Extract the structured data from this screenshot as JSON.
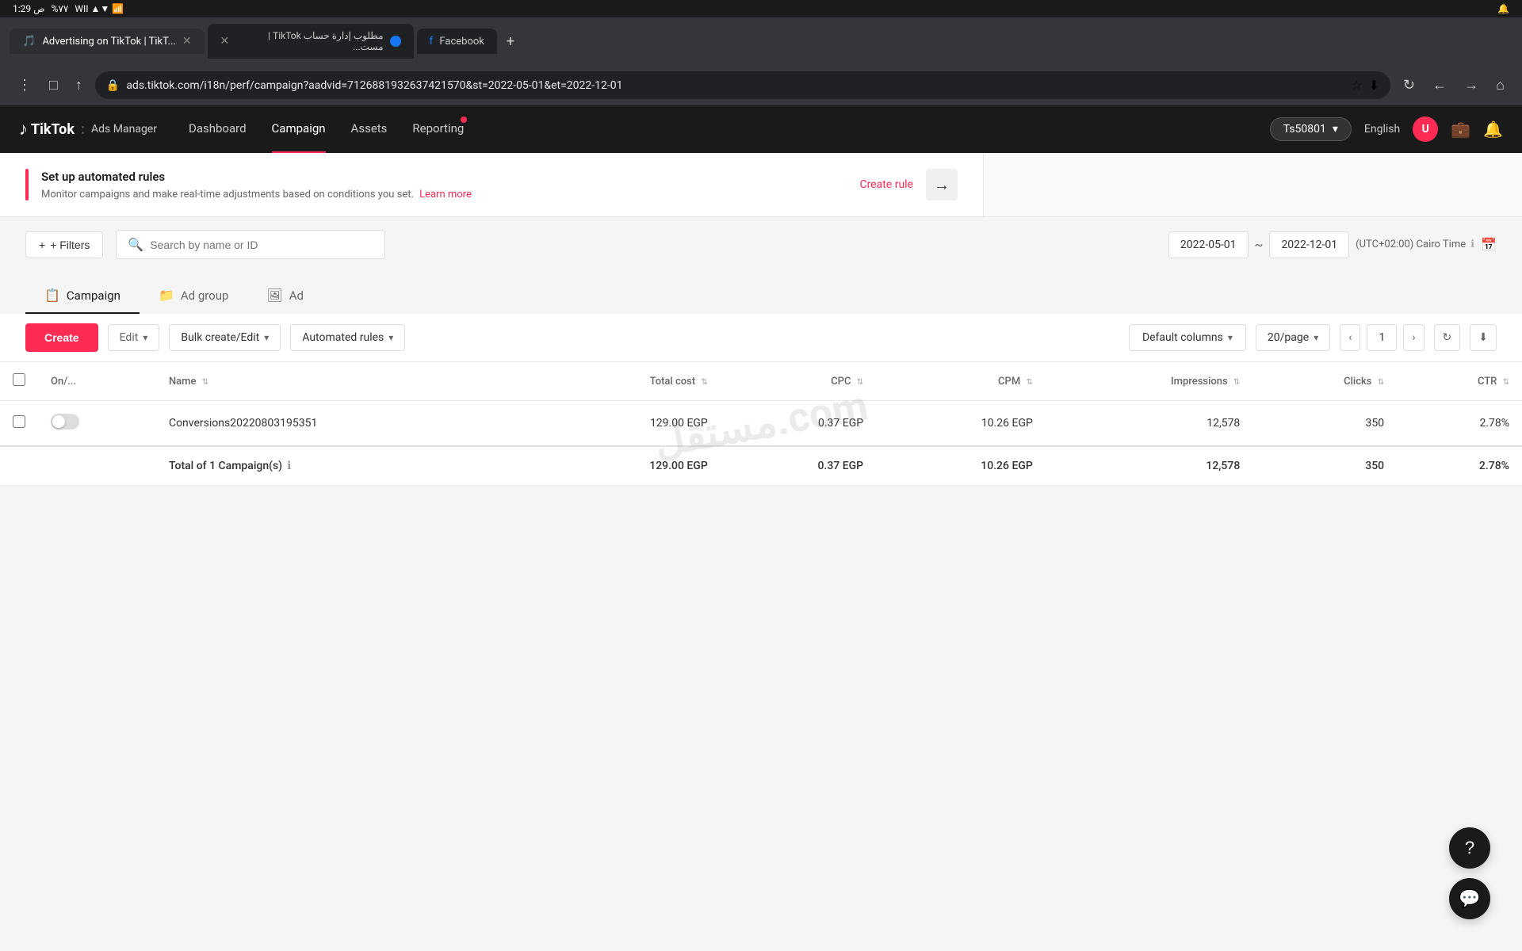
{
  "browser": {
    "status_bar": {
      "time": "1:29 ص",
      "battery": "%٧٧",
      "wifi": "WII"
    },
    "tabs": [
      {
        "id": "tab1",
        "title": "Advertising on TikTok | TikT...",
        "icon_color": "#000",
        "icon_type": "tiktok",
        "active": true,
        "has_close": true
      },
      {
        "id": "tab2",
        "title": "مطلوب إدارة حساب TikTok | مست...",
        "icon_color": "#1877f2",
        "icon_type": "circle-blue",
        "active": false,
        "has_close": true
      },
      {
        "id": "tab3",
        "title": "Facebook",
        "icon_color": "#1877f2",
        "icon_type": "facebook",
        "active": false,
        "has_close": false
      }
    ],
    "url": "ads.tiktok.com/i18n/perf/campaign?aadvid=7126881932637421570&st=2022-05-01&et=2022-12-01",
    "new_tab_label": "+",
    "back_label": "←",
    "forward_label": "→",
    "reload_label": "↻",
    "home_label": "⌂",
    "bookmark_label": "☆",
    "download_label": "⬇",
    "more_label": "⋮"
  },
  "header": {
    "logo": "TikTok",
    "logo_sub": "Ads Manager",
    "nav_items": [
      {
        "id": "dashboard",
        "label": "Dashboard",
        "active": false
      },
      {
        "id": "campaign",
        "label": "Campaign",
        "active": true
      },
      {
        "id": "assets",
        "label": "Assets",
        "active": false
      },
      {
        "id": "reporting",
        "label": "Reporting",
        "active": false,
        "has_dot": true
      }
    ],
    "account_selector": "Ts50801",
    "language": "English",
    "user_initial": "U"
  },
  "banner": {
    "left_border_color": "#fe2c55",
    "title": "Set up automated rules",
    "description": "Monitor campaigns and make real-time adjustments based on conditions you set.",
    "learn_more_label": "Learn more",
    "create_rule_label": "Create rule",
    "arrow_label": "→"
  },
  "filters": {
    "filters_label": "+ Filters",
    "search_placeholder": "Search by name or ID",
    "date_start": "2022-05-01",
    "date_end": "2022-12-01",
    "date_separator": "~",
    "timezone": "(UTC+02:00) Cairo Time",
    "timezone_info_icon": "ℹ"
  },
  "tabs": [
    {
      "id": "campaign",
      "label": "Campaign",
      "active": true,
      "icon": "📋"
    },
    {
      "id": "adgroup",
      "label": "Ad group",
      "active": false,
      "icon": "📁"
    },
    {
      "id": "ad",
      "label": "Ad",
      "active": false,
      "icon": "🖼"
    }
  ],
  "toolbar": {
    "create_label": "Create",
    "edit_label": "Edit",
    "bulk_label": "Bulk create/Edit",
    "auto_rules_label": "Automated rules",
    "columns_label": "Default columns",
    "per_page_label": "20/page",
    "page_current": "1",
    "refresh_icon": "↻",
    "export_icon": "⬇"
  },
  "table": {
    "columns": [
      {
        "id": "on_off",
        "label": "On/..."
      },
      {
        "id": "name",
        "label": "Name",
        "sortable": true
      },
      {
        "id": "total_cost",
        "label": "Total cost",
        "sortable": true,
        "align": "right"
      },
      {
        "id": "cpc",
        "label": "CPC",
        "sortable": true,
        "align": "right"
      },
      {
        "id": "cpm",
        "label": "CPM",
        "sortable": true,
        "align": "right"
      },
      {
        "id": "impressions",
        "label": "Impressions",
        "sortable": true,
        "align": "right"
      },
      {
        "id": "clicks",
        "label": "Clicks",
        "sortable": true,
        "align": "right"
      },
      {
        "id": "ctr",
        "label": "CTR",
        "sortable": true,
        "align": "right"
      }
    ],
    "rows": [
      {
        "id": "row1",
        "enabled": false,
        "name": "Conversions20220803195351",
        "total_cost": "129.00 EGP",
        "cpc": "0.37 EGP",
        "cpm": "10.26 EGP",
        "impressions": "12,578",
        "clicks": "350",
        "ctr": "2.78%"
      }
    ],
    "total": {
      "label": "Total of 1 Campaign(s)",
      "total_cost": "129.00 EGP",
      "cpc": "0.37 EGP",
      "cpm": "10.26 EGP",
      "impressions": "12,578",
      "clicks": "350",
      "ctr": "2.78%"
    }
  },
  "watermark": "مستقل.com",
  "floating": {
    "help_icon": "?",
    "chat_icon": "💬"
  }
}
